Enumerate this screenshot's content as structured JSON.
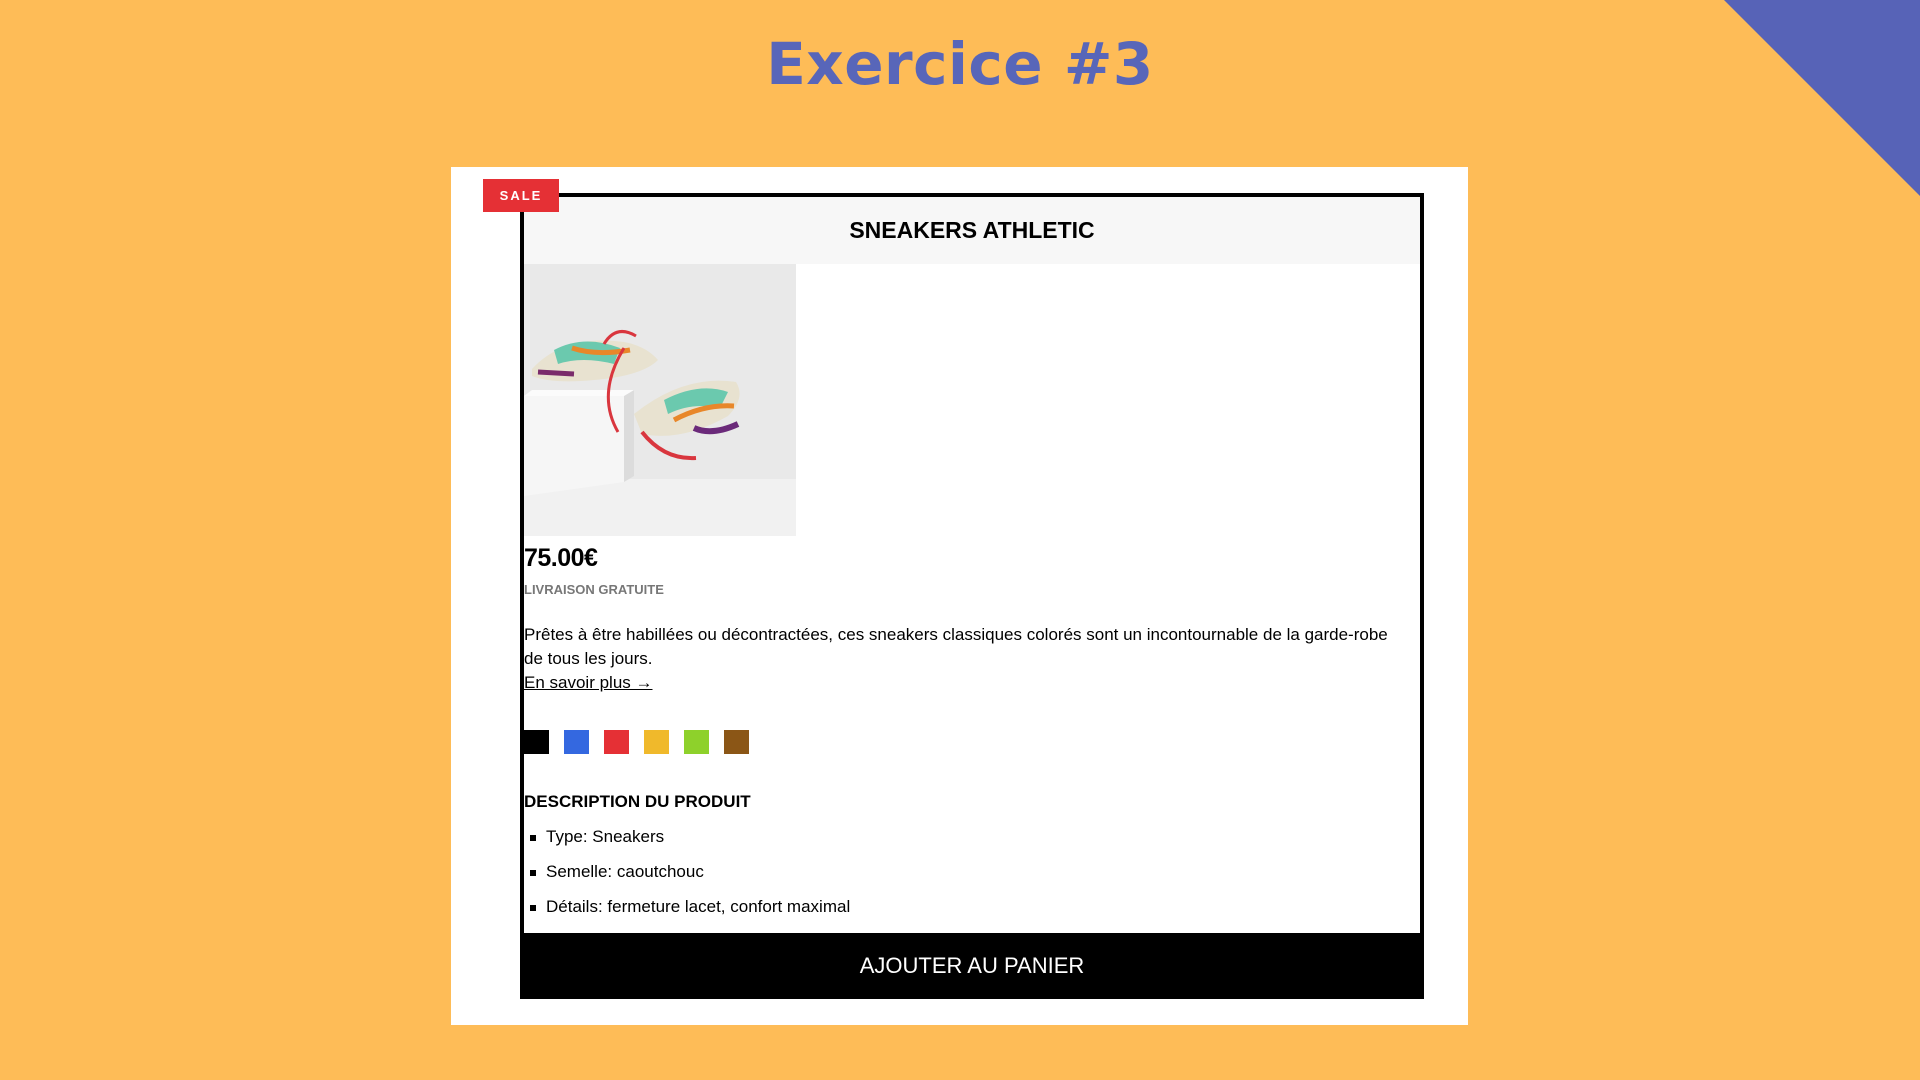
{
  "slide": {
    "title": "Exercice #3"
  },
  "badge": {
    "label": "SALE"
  },
  "product": {
    "name": "SNEAKERS ATHLETIC",
    "price": "75.00€",
    "shipping": "LIVRAISON GRATUITE",
    "description": "Prêtes à être habillées ou décontractées, ces sneakers classiques colorés sont un incontournable de la garde-robe de tous les jours.",
    "more_link": "En savoir plus →",
    "colors": [
      "#000000",
      "#3468E0",
      "#E53035",
      "#F0B92B",
      "#8ED12B",
      "#8B5616"
    ],
    "description_title": "DESCRIPTION DU PRODUIT",
    "specs": [
      "Type: Sneakers",
      "Semelle: caoutchouc",
      "Détails: fermeture lacet, confort maximal"
    ],
    "cta": "AJOUTER AU PANIER"
  },
  "theme": {
    "background": "#FEBC57",
    "accent": "#5763B7",
    "sale": "#E53035"
  }
}
